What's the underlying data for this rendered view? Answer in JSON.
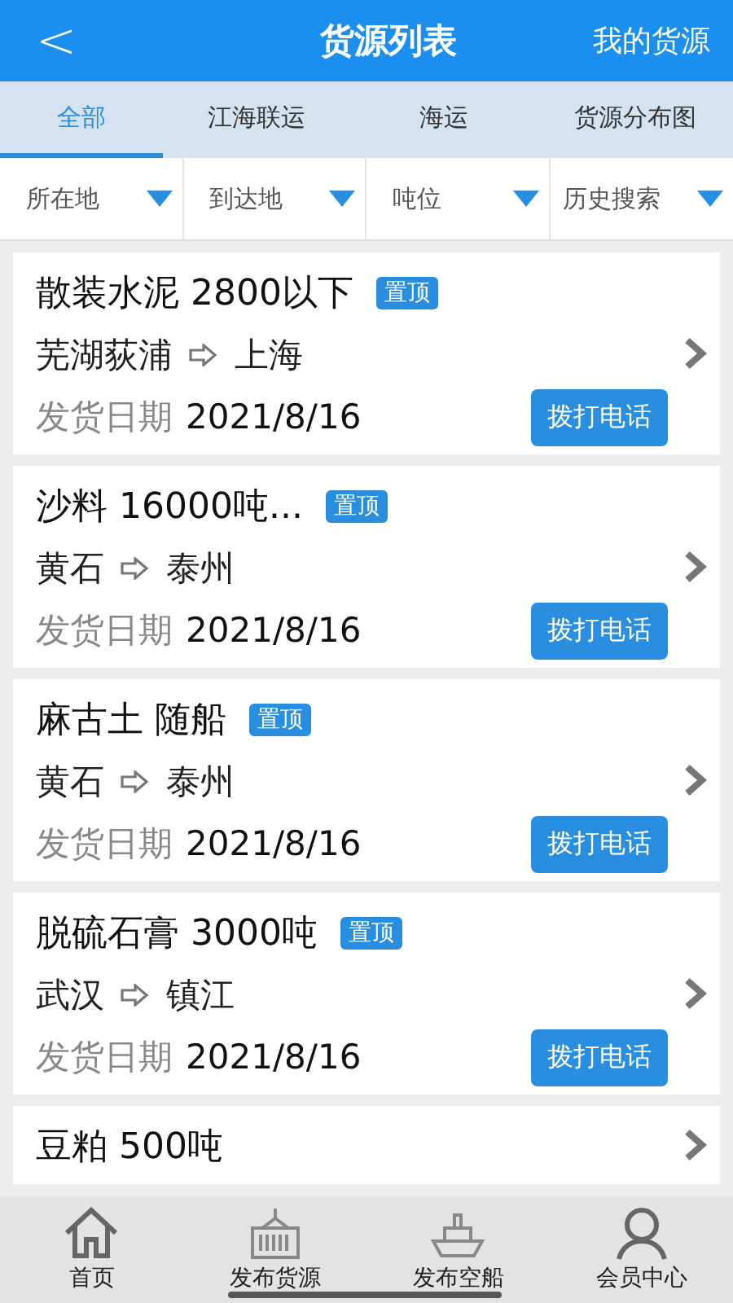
{
  "header": {
    "back": "<",
    "title": "货源列表",
    "action": "我的货源"
  },
  "tabs": [
    {
      "label": "全部",
      "selected": true
    },
    {
      "label": "江海联运",
      "selected": false
    },
    {
      "label": "海运",
      "selected": false
    },
    {
      "label": "货源分布图",
      "selected": false
    }
  ],
  "filters": [
    "所在地",
    "到达地",
    "吨位",
    "历史搜索"
  ],
  "cargo": [
    {
      "title": "散装水泥 2800以下",
      "pinned": true,
      "pin_label": "置顶",
      "from": "芜湖荻浦",
      "to": "上海",
      "date_label": "发货日期",
      "date": "2021/8/16",
      "call": "拨打电话"
    },
    {
      "title": "沙料 16000吨...",
      "pinned": true,
      "pin_label": "置顶",
      "from": "黄石",
      "to": "泰州",
      "date_label": "发货日期",
      "date": "2021/8/16",
      "call": "拨打电话"
    },
    {
      "title": "麻古土 随船",
      "pinned": true,
      "pin_label": "置顶",
      "from": "黄石",
      "to": "泰州",
      "date_label": "发货日期",
      "date": "2021/8/16",
      "call": "拨打电话"
    },
    {
      "title": "脱硫石膏 3000吨",
      "pinned": true,
      "pin_label": "置顶",
      "from": "武汉",
      "to": "镇江",
      "date_label": "发货日期",
      "date": "2021/8/16",
      "call": "拨打电话"
    },
    {
      "title": "豆粕 500吨",
      "pinned": false
    }
  ],
  "bottom_nav": [
    {
      "label": "首页",
      "kind": "home"
    },
    {
      "label": "发布货源",
      "kind": "container"
    },
    {
      "label": "发布空船",
      "kind": "ship"
    },
    {
      "label": "会员中心",
      "kind": "person"
    }
  ]
}
